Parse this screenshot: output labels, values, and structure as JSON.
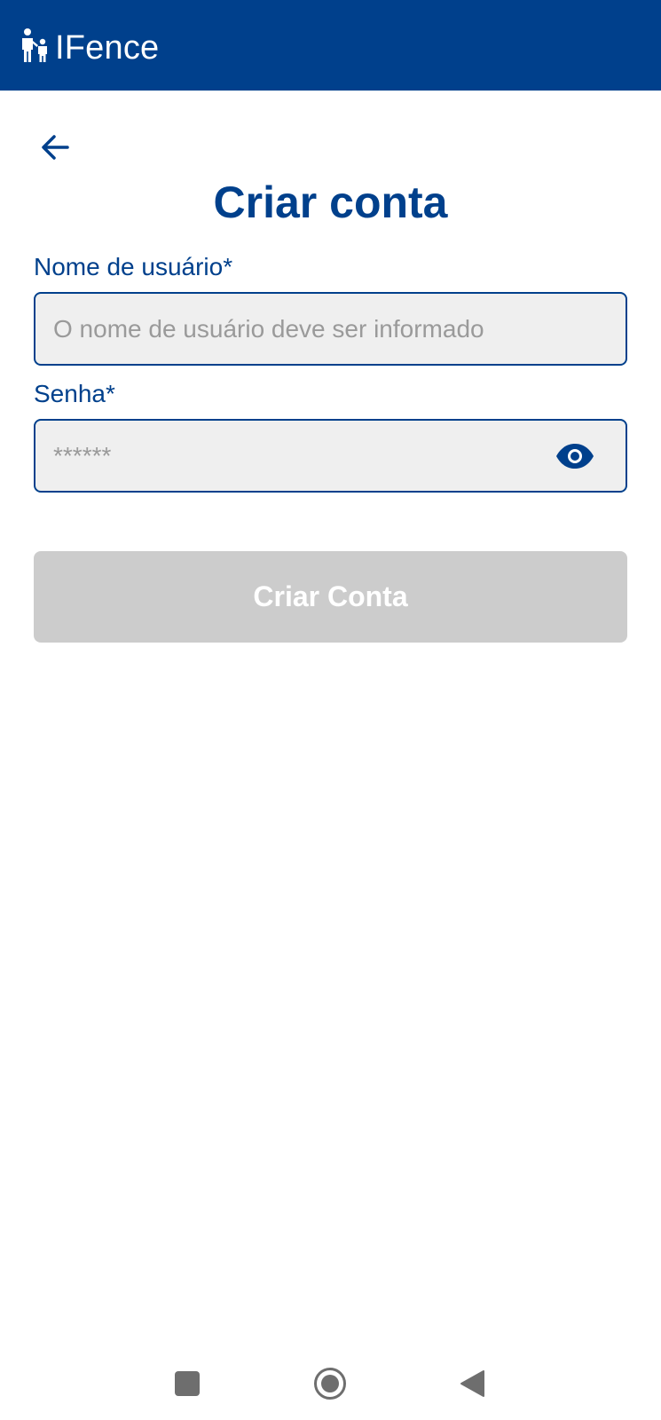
{
  "app": {
    "name": "IFence",
    "brand_color": "#00408c"
  },
  "page": {
    "title": "Criar conta",
    "back_icon": "arrow-left-icon"
  },
  "form": {
    "username": {
      "label": "Nome de usuário*",
      "placeholder": "O nome de usuário deve ser informado",
      "value": ""
    },
    "password": {
      "label": "Senha*",
      "placeholder": "******",
      "value": "",
      "visibility_icon": "eye-icon"
    },
    "submit": {
      "label": "Criar Conta",
      "enabled": false,
      "disabled_color": "#cccccc"
    }
  },
  "system_nav": {
    "recent_icon": "square-icon",
    "home_icon": "circle-icon",
    "back_icon": "triangle-back-icon"
  }
}
